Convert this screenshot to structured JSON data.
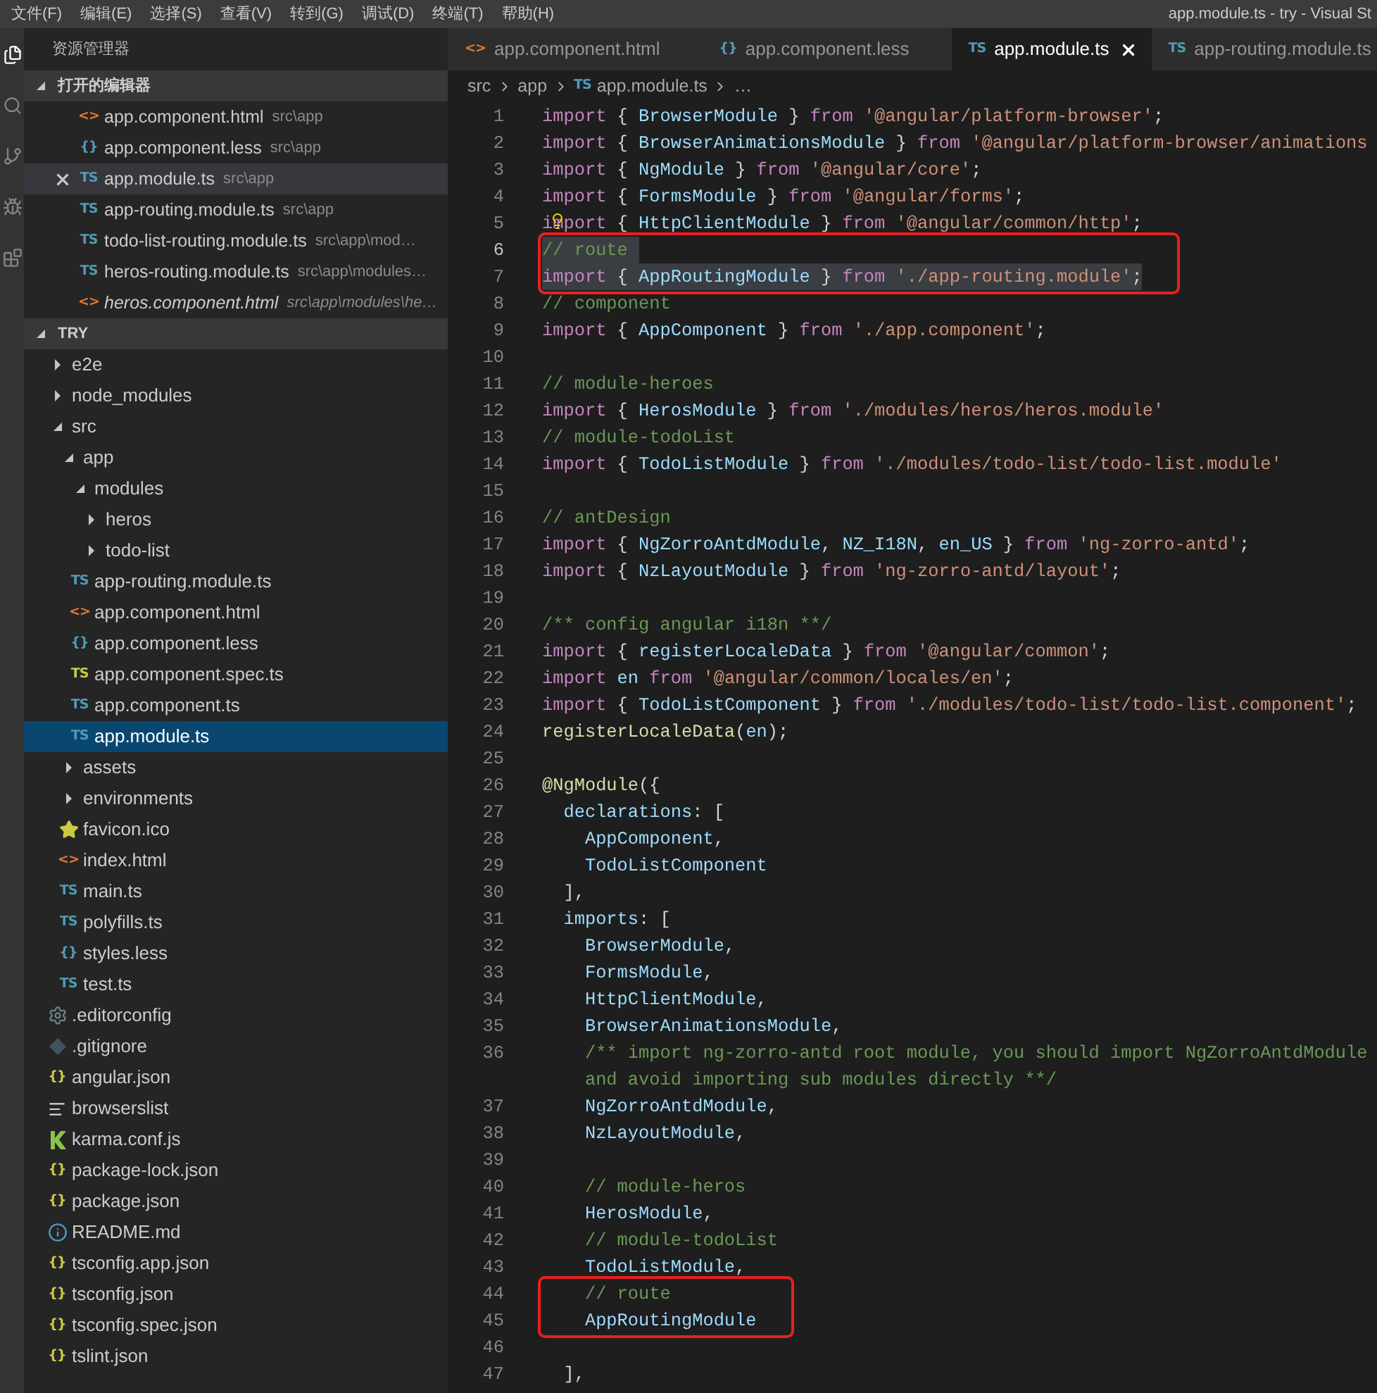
{
  "menu_bar": {
    "items": [
      "文件(F)",
      "编辑(E)",
      "选择(S)",
      "查看(V)",
      "转到(G)",
      "调试(D)",
      "终端(T)",
      "帮助(H)"
    ],
    "title": "app.module.ts - try - Visual St"
  },
  "explorer": {
    "title": "资源管理器",
    "open_editors": {
      "title": "打开的编辑器",
      "expanded": true,
      "items": [
        {
          "name": "app.component.html",
          "path": "src\\app",
          "kind": "html",
          "icon": "<>",
          "italic": false,
          "selected": false
        },
        {
          "name": "app.component.less",
          "path": "src\\app",
          "kind": "less",
          "icon": "{}",
          "italic": false,
          "selected": false
        },
        {
          "name": "app.module.ts",
          "path": "src\\app",
          "kind": "ts",
          "icon": "TS",
          "italic": false,
          "selected": true
        },
        {
          "name": "app-routing.module.ts",
          "path": "src\\app",
          "kind": "ts",
          "icon": "TS",
          "italic": false,
          "selected": false
        },
        {
          "name": "todo-list-routing.module.ts",
          "path": "src\\app\\mod…",
          "kind": "ts",
          "icon": "TS",
          "italic": false,
          "selected": false
        },
        {
          "name": "heros-routing.module.ts",
          "path": "src\\app\\modules…",
          "kind": "ts",
          "icon": "TS",
          "italic": false,
          "selected": false
        },
        {
          "name": "heros.component.html",
          "path": "src\\app\\modules\\he…",
          "kind": "html",
          "icon": "<>",
          "italic": true,
          "selected": false
        }
      ]
    },
    "project": {
      "title": "TRY",
      "expanded": true,
      "items": [
        {
          "name": "e2e",
          "kind": "folder",
          "expanded": false,
          "selected": false
        },
        {
          "name": "node_modules",
          "kind": "folder",
          "expanded": false,
          "selected": false
        },
        {
          "name": "src",
          "kind": "folder",
          "expanded": true,
          "selected": false,
          "children": [
            {
              "name": "app",
              "kind": "folder",
              "expanded": true,
              "selected": false,
              "children": [
                {
                  "name": "modules",
                  "kind": "folder",
                  "expanded": true,
                  "selected": false,
                  "children": [
                    {
                      "name": "heros",
                      "kind": "folder",
                      "expanded": false,
                      "selected": false
                    },
                    {
                      "name": "todo-list",
                      "kind": "folder",
                      "expanded": false,
                      "selected": false
                    }
                  ]
                },
                {
                  "name": "app-routing.module.ts",
                  "kind": "ts",
                  "icon": "TS",
                  "selected": false
                },
                {
                  "name": "app.component.html",
                  "kind": "html",
                  "icon": "<>",
                  "selected": false
                },
                {
                  "name": "app.component.less",
                  "kind": "less",
                  "icon": "{}",
                  "selected": false
                },
                {
                  "name": "app.component.spec.ts",
                  "kind": "spec",
                  "icon": "TS",
                  "selected": false
                },
                {
                  "name": "app.component.ts",
                  "kind": "ts",
                  "icon": "TS",
                  "selected": false
                },
                {
                  "name": "app.module.ts",
                  "kind": "ts",
                  "icon": "TS",
                  "selected": true
                }
              ]
            },
            {
              "name": "assets",
              "kind": "folder",
              "expanded": false,
              "selected": false
            },
            {
              "name": "environments",
              "kind": "folder",
              "expanded": false,
              "selected": false
            },
            {
              "name": "favicon.ico",
              "kind": "image",
              "selected": false
            },
            {
              "name": "index.html",
              "kind": "html",
              "icon": "<>",
              "selected": false
            },
            {
              "name": "main.ts",
              "kind": "ts",
              "icon": "TS",
              "selected": false
            },
            {
              "name": "polyfills.ts",
              "kind": "ts",
              "icon": "TS",
              "selected": false
            },
            {
              "name": "styles.less",
              "kind": "less",
              "icon": "{}",
              "selected": false
            },
            {
              "name": "test.ts",
              "kind": "ts",
              "icon": "TS",
              "selected": false
            }
          ]
        },
        {
          "name": ".editorconfig",
          "kind": "config",
          "selected": false
        },
        {
          "name": ".gitignore",
          "kind": "git",
          "selected": false
        },
        {
          "name": "angular.json",
          "kind": "json",
          "icon": "{}",
          "selected": false
        },
        {
          "name": "browserslist",
          "kind": "text",
          "selected": false
        },
        {
          "name": "karma.conf.js",
          "kind": "karma",
          "selected": false
        },
        {
          "name": "package-lock.json",
          "kind": "json",
          "icon": "{}",
          "selected": false
        },
        {
          "name": "package.json",
          "kind": "json",
          "icon": "{}",
          "selected": false
        },
        {
          "name": "README.md",
          "kind": "info",
          "selected": false
        },
        {
          "name": "tsconfig.app.json",
          "kind": "json",
          "icon": "{}",
          "selected": false
        },
        {
          "name": "tsconfig.json",
          "kind": "json",
          "icon": "{}",
          "selected": false
        },
        {
          "name": "tsconfig.spec.json",
          "kind": "json",
          "icon": "{}",
          "selected": false
        },
        {
          "name": "tslint.json",
          "kind": "json",
          "icon": "{}",
          "selected": false
        }
      ]
    }
  },
  "tabs": [
    {
      "label": "app.component.html",
      "kind": "html",
      "icon": "<>",
      "selected": false
    },
    {
      "label": "app.component.less",
      "kind": "less",
      "icon": "{}",
      "selected": false
    },
    {
      "label": "app.module.ts",
      "kind": "ts",
      "icon": "TS",
      "selected": true
    },
    {
      "label": "app-routing.module.ts",
      "kind": "ts",
      "icon": "TS",
      "selected": false
    }
  ],
  "breadcrumb": [
    {
      "label": "src"
    },
    {
      "label": "app"
    },
    {
      "label": "app.module.ts",
      "kind": "ts",
      "icon": "TS"
    },
    {
      "label": "…"
    }
  ],
  "code": {
    "lines": [
      {
        "number": "1",
        "current": false,
        "selected": false,
        "boxed": false,
        "lightbulb": false,
        "tokens": [
          {
            "kind": "keyword",
            "text": "import"
          },
          {
            "kind": "punct",
            "text": " { "
          },
          {
            "kind": "name",
            "text": "BrowserModule"
          },
          {
            "kind": "punct",
            "text": " } "
          },
          {
            "kind": "keyword",
            "text": "from "
          },
          {
            "kind": "string",
            "text": "'@angular/platform-browser'"
          },
          {
            "kind": "punct",
            "text": ";"
          }
        ]
      },
      {
        "number": "2",
        "current": false,
        "selected": false,
        "boxed": false,
        "lightbulb": false,
        "tokens": [
          {
            "kind": "keyword",
            "text": "import"
          },
          {
            "kind": "punct",
            "text": " { "
          },
          {
            "kind": "name",
            "text": "BrowserAnimationsModule"
          },
          {
            "kind": "punct",
            "text": " } "
          },
          {
            "kind": "keyword",
            "text": "from "
          },
          {
            "kind": "string",
            "text": "'@angular/platform-browser/animations"
          }
        ]
      },
      {
        "number": "3",
        "current": false,
        "selected": false,
        "boxed": false,
        "lightbulb": false,
        "tokens": [
          {
            "kind": "keyword",
            "text": "import"
          },
          {
            "kind": "punct",
            "text": " { "
          },
          {
            "kind": "name",
            "text": "NgModule"
          },
          {
            "kind": "punct",
            "text": " } "
          },
          {
            "kind": "keyword",
            "text": "from "
          },
          {
            "kind": "string",
            "text": "'@angular/core'"
          },
          {
            "kind": "punct",
            "text": ";"
          }
        ]
      },
      {
        "number": "4",
        "current": false,
        "selected": false,
        "boxed": false,
        "lightbulb": false,
        "tokens": [
          {
            "kind": "keyword",
            "text": "import"
          },
          {
            "kind": "punct",
            "text": " { "
          },
          {
            "kind": "name",
            "text": "FormsModule"
          },
          {
            "kind": "punct",
            "text": " } "
          },
          {
            "kind": "keyword",
            "text": "from "
          },
          {
            "kind": "string",
            "text": "'@angular/forms'"
          },
          {
            "kind": "punct",
            "text": ";"
          }
        ]
      },
      {
        "number": "5",
        "current": false,
        "selected": false,
        "boxed": false,
        "lightbulb": true,
        "tokens": [
          {
            "kind": "keyword",
            "text": "import"
          },
          {
            "kind": "punct",
            "text": " { "
          },
          {
            "kind": "name",
            "text": "HttpClientModule"
          },
          {
            "kind": "punct",
            "text": " } "
          },
          {
            "kind": "keyword",
            "text": "from "
          },
          {
            "kind": "string",
            "text": "'@angular/common/http'"
          },
          {
            "kind": "punct",
            "text": ";"
          }
        ]
      },
      {
        "number": "6",
        "current": true,
        "selected": true,
        "boxed": true,
        "lightbulb": false,
        "tokens": [
          {
            "kind": "comment",
            "text": "// route "
          }
        ]
      },
      {
        "number": "7",
        "current": false,
        "selected": true,
        "boxed": true,
        "lightbulb": false,
        "tokens": [
          {
            "kind": "keyword",
            "text": "import"
          },
          {
            "kind": "punct",
            "text": " { "
          },
          {
            "kind": "name",
            "text": "AppRoutingModule"
          },
          {
            "kind": "punct",
            "text": " } "
          },
          {
            "kind": "keyword",
            "text": "from "
          },
          {
            "kind": "string",
            "text": "'./app-routing.module'"
          },
          {
            "kind": "punct",
            "text": ";"
          }
        ]
      },
      {
        "number": "8",
        "current": false,
        "selected": false,
        "boxed": false,
        "lightbulb": false,
        "tokens": [
          {
            "kind": "comment",
            "text": "// component"
          }
        ]
      },
      {
        "number": "9",
        "current": false,
        "selected": false,
        "boxed": false,
        "lightbulb": false,
        "tokens": [
          {
            "kind": "keyword",
            "text": "import"
          },
          {
            "kind": "punct",
            "text": " { "
          },
          {
            "kind": "name",
            "text": "AppComponent"
          },
          {
            "kind": "punct",
            "text": " } "
          },
          {
            "kind": "keyword",
            "text": "from "
          },
          {
            "kind": "string",
            "text": "'./app.component'"
          },
          {
            "kind": "punct",
            "text": ";"
          }
        ]
      },
      {
        "number": "10",
        "current": false
      },
      {
        "number": "11",
        "current": false,
        "selected": false,
        "boxed": false,
        "lightbulb": false,
        "tokens": [
          {
            "kind": "comment",
            "text": "// module-heroes"
          }
        ]
      },
      {
        "number": "12",
        "current": false,
        "selected": false,
        "boxed": false,
        "lightbulb": false,
        "tokens": [
          {
            "kind": "keyword",
            "text": "import"
          },
          {
            "kind": "punct",
            "text": " { "
          },
          {
            "kind": "name",
            "text": "HerosModule"
          },
          {
            "kind": "punct",
            "text": " } "
          },
          {
            "kind": "keyword",
            "text": "from "
          },
          {
            "kind": "string",
            "text": "'./modules/heros/heros.module'"
          }
        ]
      },
      {
        "number": "13",
        "current": false,
        "selected": false,
        "boxed": false,
        "lightbulb": false,
        "tokens": [
          {
            "kind": "comment",
            "text": "// module-todoList"
          }
        ]
      },
      {
        "number": "14",
        "current": false,
        "selected": false,
        "boxed": false,
        "lightbulb": false,
        "tokens": [
          {
            "kind": "keyword",
            "text": "import"
          },
          {
            "kind": "punct",
            "text": " { "
          },
          {
            "kind": "name",
            "text": "TodoListModule"
          },
          {
            "kind": "punct",
            "text": " } "
          },
          {
            "kind": "keyword",
            "text": "from "
          },
          {
            "kind": "string",
            "text": "'./modules/todo-list/todo-list.module'"
          }
        ]
      },
      {
        "number": "15",
        "current": false
      },
      {
        "number": "16",
        "current": false,
        "selected": false,
        "boxed": false,
        "lightbulb": false,
        "tokens": [
          {
            "kind": "comment",
            "text": "// antDesign"
          }
        ]
      },
      {
        "number": "17",
        "current": false,
        "selected": false,
        "boxed": false,
        "lightbulb": false,
        "tokens": [
          {
            "kind": "keyword",
            "text": "import"
          },
          {
            "kind": "punct",
            "text": " { "
          },
          {
            "kind": "name",
            "text": "NgZorroAntdModule"
          },
          {
            "kind": "punct",
            "text": ", "
          },
          {
            "kind": "name",
            "text": "NZ_I18N"
          },
          {
            "kind": "punct",
            "text": ", "
          },
          {
            "kind": "name",
            "text": "en_US"
          },
          {
            "kind": "punct",
            "text": " } "
          },
          {
            "kind": "keyword",
            "text": "from "
          },
          {
            "kind": "string",
            "text": "'ng-zorro-antd'"
          },
          {
            "kind": "punct",
            "text": ";"
          }
        ]
      },
      {
        "number": "18",
        "current": false,
        "selected": false,
        "boxed": false,
        "lightbulb": false,
        "tokens": [
          {
            "kind": "keyword",
            "text": "import"
          },
          {
            "kind": "punct",
            "text": " { "
          },
          {
            "kind": "name",
            "text": "NzLayoutModule"
          },
          {
            "kind": "punct",
            "text": " } "
          },
          {
            "kind": "keyword",
            "text": "from "
          },
          {
            "kind": "string",
            "text": "'ng-zorro-antd/layout'"
          },
          {
            "kind": "punct",
            "text": ";"
          }
        ]
      },
      {
        "number": "19",
        "current": false
      },
      {
        "number": "20",
        "current": false,
        "selected": false,
        "boxed": false,
        "lightbulb": false,
        "tokens": [
          {
            "kind": "comment",
            "text": "/** config angular i18n **/"
          }
        ]
      },
      {
        "number": "21",
        "current": false,
        "selected": false,
        "boxed": false,
        "lightbulb": false,
        "tokens": [
          {
            "kind": "keyword",
            "text": "import"
          },
          {
            "kind": "punct",
            "text": " { "
          },
          {
            "kind": "name",
            "text": "registerLocaleData"
          },
          {
            "kind": "punct",
            "text": " } "
          },
          {
            "kind": "keyword",
            "text": "from "
          },
          {
            "kind": "string",
            "text": "'@angular/common'"
          },
          {
            "kind": "punct",
            "text": ";"
          }
        ]
      },
      {
        "number": "22",
        "current": false,
        "selected": false,
        "boxed": false,
        "lightbulb": false,
        "tokens": [
          {
            "kind": "keyword",
            "text": "import "
          },
          {
            "kind": "name",
            "text": "en "
          },
          {
            "kind": "keyword",
            "text": "from "
          },
          {
            "kind": "string",
            "text": "'@angular/common/locales/en'"
          },
          {
            "kind": "punct",
            "text": ";"
          }
        ]
      },
      {
        "number": "23",
        "current": false,
        "selected": false,
        "boxed": false,
        "lightbulb": false,
        "tokens": [
          {
            "kind": "keyword",
            "text": "import"
          },
          {
            "kind": "punct",
            "text": " { "
          },
          {
            "kind": "name",
            "text": "TodoListComponent"
          },
          {
            "kind": "punct",
            "text": " } "
          },
          {
            "kind": "keyword",
            "text": "from "
          },
          {
            "kind": "string",
            "text": "'./modules/todo-list/todo-list.component'"
          },
          {
            "kind": "punct",
            "text": ";"
          }
        ]
      },
      {
        "number": "24",
        "current": false,
        "selected": false,
        "boxed": false,
        "lightbulb": false,
        "tokens": [
          {
            "kind": "func",
            "text": "registerLocaleData"
          },
          {
            "kind": "punct",
            "text": "("
          },
          {
            "kind": "name",
            "text": "en"
          },
          {
            "kind": "punct",
            "text": ");"
          }
        ]
      },
      {
        "number": "25",
        "current": false
      },
      {
        "number": "26",
        "current": false,
        "selected": false,
        "boxed": false,
        "lightbulb": false,
        "tokens": [
          {
            "kind": "func",
            "text": "@NgModule"
          },
          {
            "kind": "punct",
            "text": "({"
          }
        ]
      },
      {
        "number": "27",
        "current": false,
        "selected": false,
        "boxed": false,
        "lightbulb": false,
        "tokens": [
          {
            "kind": "name",
            "text": "  declarations"
          },
          {
            "kind": "punct",
            "text": ": ["
          }
        ]
      },
      {
        "number": "28",
        "current": false,
        "selected": false,
        "boxed": false,
        "lightbulb": false,
        "tokens": [
          {
            "kind": "name",
            "text": "    AppComponent"
          },
          {
            "kind": "punct",
            "text": ","
          }
        ]
      },
      {
        "number": "29",
        "current": false,
        "selected": false,
        "boxed": false,
        "lightbulb": false,
        "tokens": [
          {
            "kind": "name",
            "text": "    TodoListComponent"
          }
        ]
      },
      {
        "number": "30",
        "current": false,
        "selected": false,
        "boxed": false,
        "lightbulb": false,
        "tokens": [
          {
            "kind": "punct",
            "text": "  ],"
          }
        ]
      },
      {
        "number": "31",
        "current": false,
        "selected": false,
        "boxed": false,
        "lightbulb": false,
        "tokens": [
          {
            "kind": "name",
            "text": "  imports"
          },
          {
            "kind": "punct",
            "text": ": ["
          }
        ]
      },
      {
        "number": "32",
        "current": false,
        "selected": false,
        "boxed": false,
        "lightbulb": false,
        "tokens": [
          {
            "kind": "name",
            "text": "    BrowserModule"
          },
          {
            "kind": "punct",
            "text": ","
          }
        ]
      },
      {
        "number": "33",
        "current": false,
        "selected": false,
        "boxed": false,
        "lightbulb": false,
        "tokens": [
          {
            "kind": "name",
            "text": "    FormsModule"
          },
          {
            "kind": "punct",
            "text": ","
          }
        ]
      },
      {
        "number": "34",
        "current": false,
        "selected": false,
        "boxed": false,
        "lightbulb": false,
        "tokens": [
          {
            "kind": "name",
            "text": "    HttpClientModule"
          },
          {
            "kind": "punct",
            "text": ","
          }
        ]
      },
      {
        "number": "35",
        "current": false,
        "selected": false,
        "boxed": false,
        "lightbulb": false,
        "tokens": [
          {
            "kind": "name",
            "text": "    BrowserAnimationsModule"
          },
          {
            "kind": "punct",
            "text": ","
          }
        ]
      },
      {
        "number": "36",
        "current": false,
        "selected": false,
        "boxed": false,
        "lightbulb": false,
        "tokens": [
          {
            "kind": "comment",
            "text": "    /** import ng-zorro-antd root module, you should import NgZorroAntdModule"
          }
        ],
        "continuation": {
          "kind": "comment",
          "text": "and avoid importing sub modules directly **/"
        }
      },
      {
        "number": "37",
        "current": false,
        "selected": false,
        "boxed": false,
        "lightbulb": false,
        "tokens": [
          {
            "kind": "name",
            "text": "    NgZorroAntdModule"
          },
          {
            "kind": "punct",
            "text": ","
          }
        ]
      },
      {
        "number": "38",
        "current": false,
        "selected": false,
        "boxed": false,
        "lightbulb": false,
        "tokens": [
          {
            "kind": "name",
            "text": "    NzLayoutModule"
          },
          {
            "kind": "punct",
            "text": ","
          }
        ]
      },
      {
        "number": "39",
        "current": false
      },
      {
        "number": "40",
        "current": false,
        "selected": false,
        "boxed": false,
        "lightbulb": false,
        "tokens": [
          {
            "kind": "comment",
            "text": "    // module-heros"
          }
        ]
      },
      {
        "number": "41",
        "current": false,
        "selected": false,
        "boxed": false,
        "lightbulb": false,
        "tokens": [
          {
            "kind": "name",
            "text": "    HerosModule"
          },
          {
            "kind": "punct",
            "text": ","
          }
        ]
      },
      {
        "number": "42",
        "current": false,
        "selected": false,
        "boxed": false,
        "lightbulb": false,
        "tokens": [
          {
            "kind": "comment",
            "text": "    // module-todoList"
          }
        ]
      },
      {
        "number": "43",
        "current": false,
        "selected": false,
        "boxed": false,
        "lightbulb": false,
        "tokens": [
          {
            "kind": "name",
            "text": "    TodoListModule"
          },
          {
            "kind": "punct",
            "text": ","
          }
        ]
      },
      {
        "number": "44",
        "current": false,
        "selected": false,
        "boxed": true,
        "lightbulb": false,
        "tokens": [
          {
            "kind": "comment",
            "text": "    // route"
          }
        ]
      },
      {
        "number": "45",
        "current": false,
        "selected": false,
        "boxed": true,
        "lightbulb": false,
        "tokens": [
          {
            "kind": "name",
            "text": "    AppRoutingModule"
          }
        ]
      },
      {
        "number": "46",
        "current": false
      },
      {
        "number": "47",
        "current": false,
        "selected": false,
        "boxed": false,
        "lightbulb": false,
        "tokens": [
          {
            "kind": "punct",
            "text": "  ],"
          }
        ]
      }
    ]
  }
}
